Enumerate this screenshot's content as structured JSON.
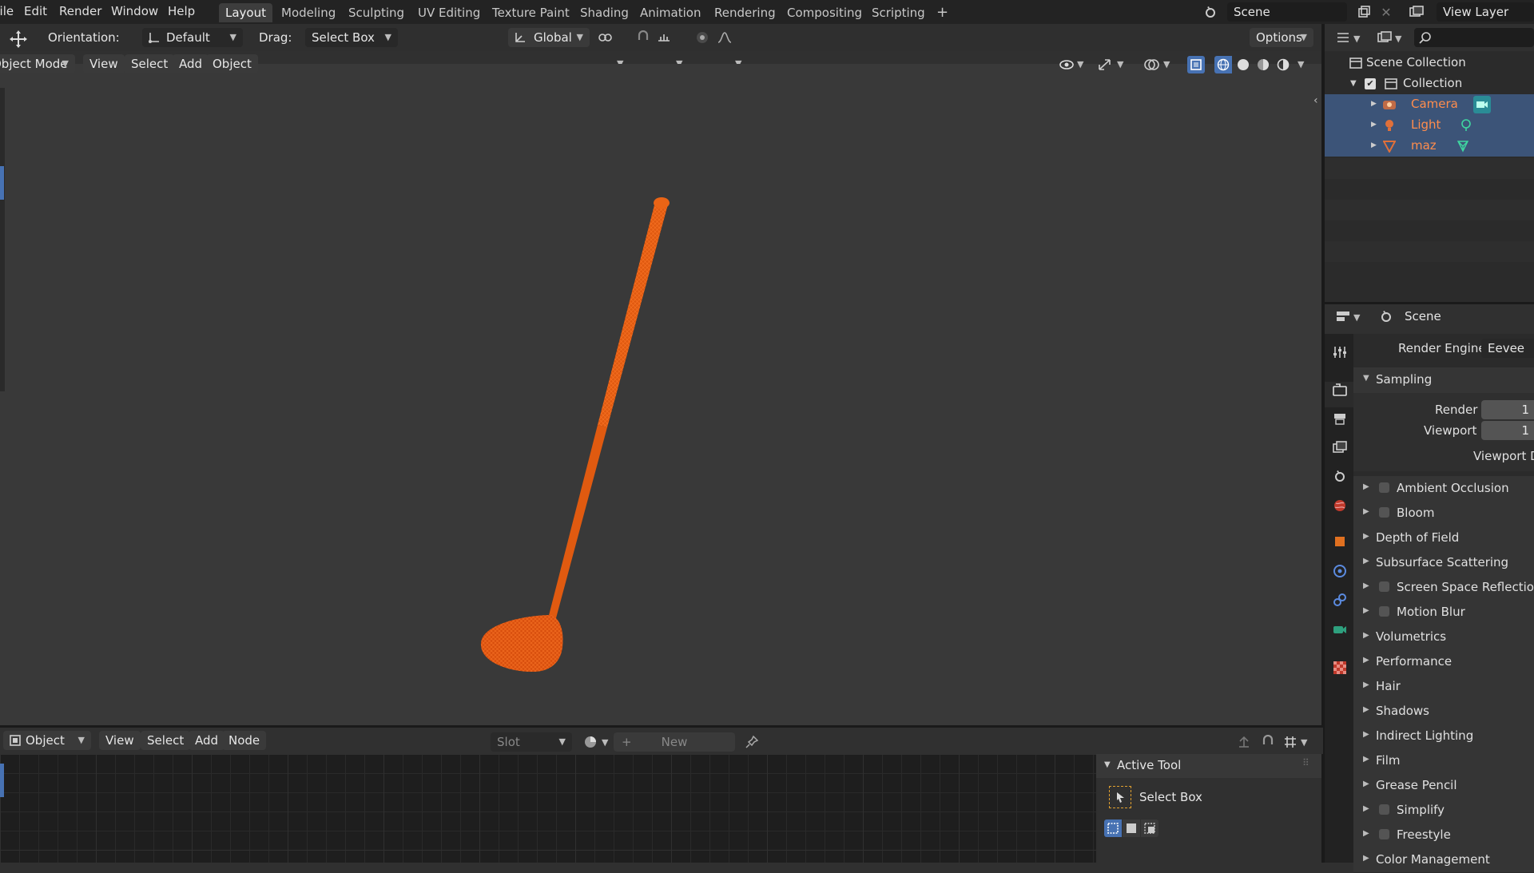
{
  "menu": [
    "File",
    "Edit",
    "Render",
    "Window",
    "Help"
  ],
  "workspace_tabs": [
    "Layout",
    "Modeling",
    "Sculpting",
    "UV Editing",
    "Texture Paint",
    "Shading",
    "Animation",
    "Rendering",
    "Compositing",
    "Scripting"
  ],
  "active_workspace": "Layout",
  "scene_name": "Scene",
  "view_layer": "View Layer",
  "tool_header": {
    "orientation_label": "Orientation:",
    "orientation_value": "Default",
    "drag_label": "Drag:",
    "drag_value": "Select Box",
    "transform_space": "Global",
    "options": "Options"
  },
  "viewport_header": {
    "mode": "Object Mode",
    "menus": [
      "View",
      "Select",
      "Add",
      "Object"
    ]
  },
  "shader_header": {
    "mode": "Object",
    "menus": [
      "View",
      "Select",
      "Add",
      "Node"
    ],
    "slot": "Slot",
    "new_label": "New"
  },
  "active_tool": {
    "title": "Active Tool",
    "tool_name": "Select Box"
  },
  "outliner": {
    "scene_collection": "Scene Collection",
    "collection": "Collection",
    "items": [
      {
        "name": "Camera",
        "color": "#e0703a"
      },
      {
        "name": "Light",
        "color": "#e0703a"
      },
      {
        "name": "maz",
        "color": "#e0703a"
      }
    ]
  },
  "properties": {
    "context": "Scene",
    "render_engine_label": "Render Engine",
    "render_engine_value": "Eevee",
    "sampling": {
      "title": "Sampling",
      "render_label": "Render",
      "render_value": "1",
      "viewport_label": "Viewport",
      "viewport_value": "1",
      "viewport_denoising": "Viewport De"
    },
    "panels": [
      {
        "label": "Ambient Occlusion",
        "checkbox": true
      },
      {
        "label": "Bloom",
        "checkbox": true
      },
      {
        "label": "Depth of Field",
        "checkbox": false
      },
      {
        "label": "Subsurface Scattering",
        "checkbox": false
      },
      {
        "label": "Screen Space Reflection",
        "checkbox": true
      },
      {
        "label": "Motion Blur",
        "checkbox": true
      },
      {
        "label": "Volumetrics",
        "checkbox": false
      },
      {
        "label": "Performance",
        "checkbox": false
      },
      {
        "label": "Hair",
        "checkbox": false
      },
      {
        "label": "Shadows",
        "checkbox": false
      },
      {
        "label": "Indirect Lighting",
        "checkbox": false
      },
      {
        "label": "Film",
        "checkbox": false
      },
      {
        "label": "Grease Pencil",
        "checkbox": false
      },
      {
        "label": "Simplify",
        "checkbox": true
      },
      {
        "label": "Freestyle",
        "checkbox": true
      },
      {
        "label": "Color Management",
        "checkbox": false
      }
    ]
  },
  "colors": {
    "selection": "#3c5478",
    "object_orange": "#e05a10",
    "accent_blue": "#4772b3"
  }
}
